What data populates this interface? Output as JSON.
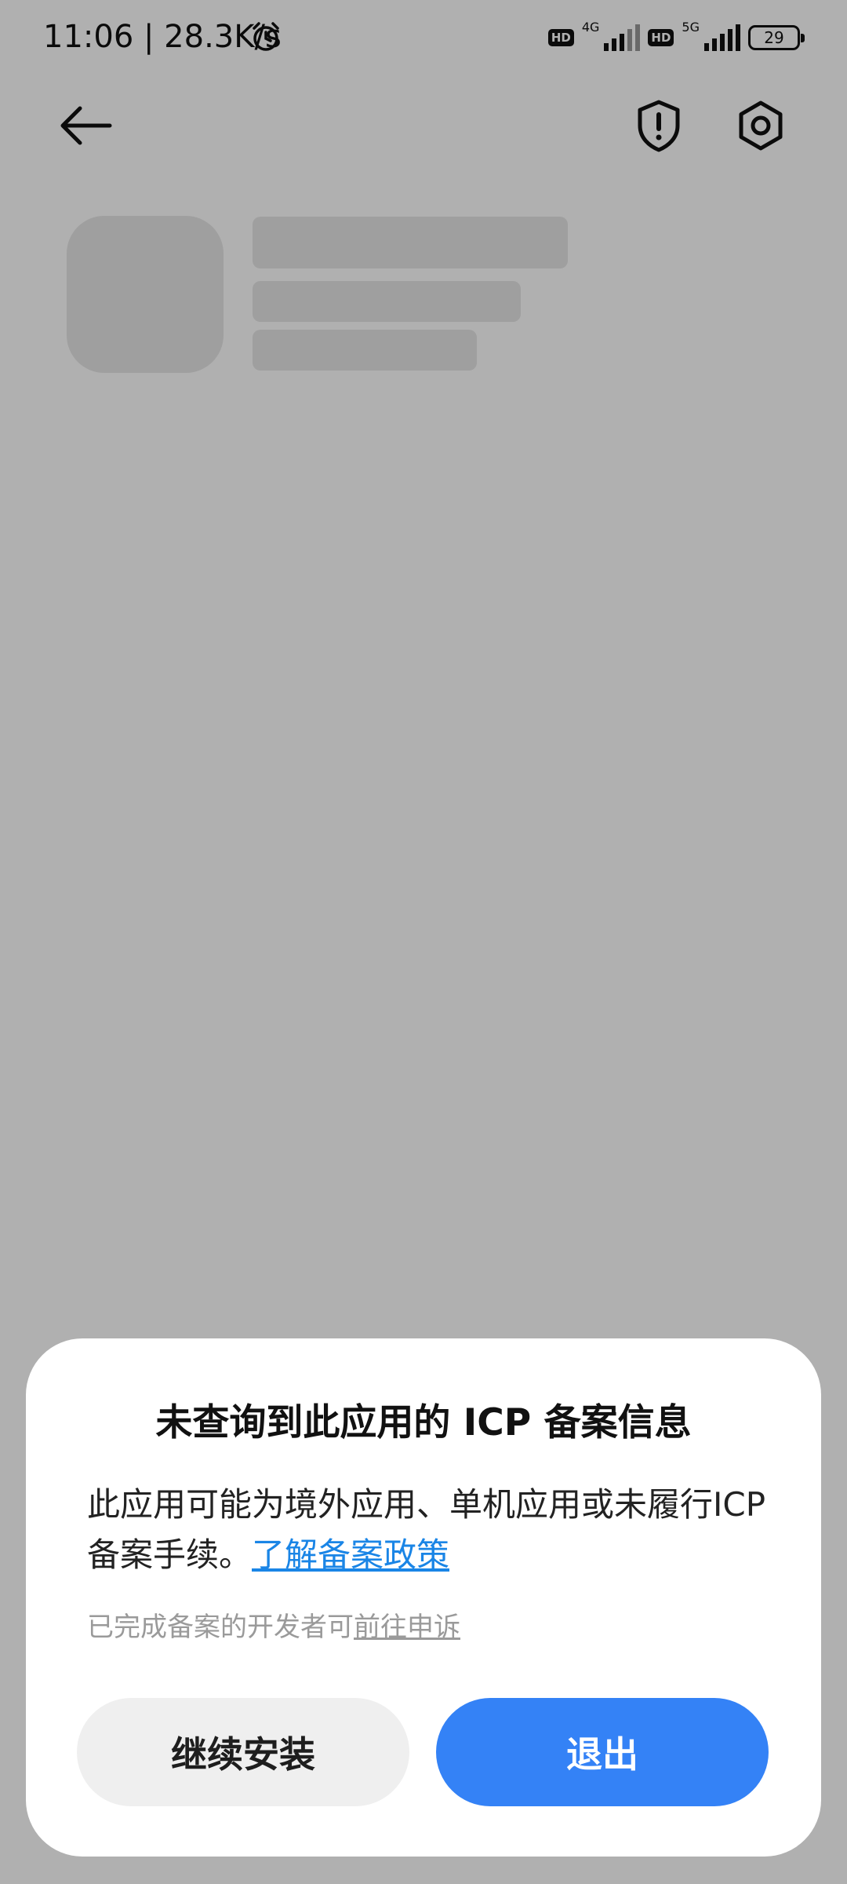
{
  "status_bar": {
    "time_speed": "11:06 | 28.3K/s",
    "sim1_badge": "HD",
    "sim1_network": "4G",
    "sim2_badge": "HD",
    "sim2_network": "5G",
    "battery": "29",
    "icons": [
      "alarm-icon",
      "signal-icon",
      "battery-icon"
    ]
  },
  "toolbar": {
    "icons": [
      "back-arrow-icon",
      "shield-exclamation-icon",
      "settings-gear-icon"
    ]
  },
  "dialog": {
    "title": "未查询到此应用的 ICP 备案信息",
    "body_text": "此应用可能为境外应用、单机应用或未履行ICP 备案手续。",
    "policy_link": "了解备案政策",
    "note_text": "已完成备案的开发者可",
    "appeal_link": "前往申诉",
    "continue_button": "继续安装",
    "exit_button": "退出"
  },
  "colors": {
    "primary": "#3482f6",
    "link": "#1a85e6",
    "scrim": "#00000050"
  }
}
